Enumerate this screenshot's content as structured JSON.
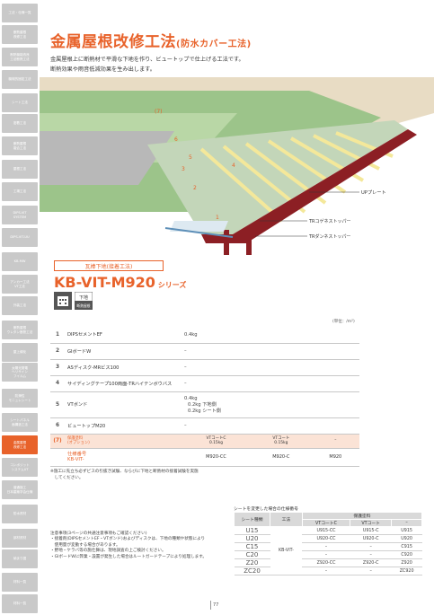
{
  "sidebar": {
    "items": [
      {
        "label": "工法・仕様一覧",
        "active": false
      },
      {
        "label": "断熱屋根\n改修工法",
        "active": false
      },
      {
        "label": "断熱機能改良\n工法断熱工法",
        "active": false
      },
      {
        "label": "機械的固定工法",
        "active": false
      },
      {
        "label": "シート工法",
        "active": false
      },
      {
        "label": "密着工法",
        "active": false
      },
      {
        "label": "断熱屋根\n複合工法",
        "active": false
      },
      {
        "label": "屋根工法",
        "active": false
      },
      {
        "label": "工場工法",
        "active": false
      },
      {
        "label": "DIPS-VIT\nSYSTEM",
        "active": false
      },
      {
        "label": "DIPS-VIT-UU",
        "active": false
      },
      {
        "label": "KB-MW",
        "active": false
      },
      {
        "label": "アンカー工法\nVT工法",
        "active": false
      },
      {
        "label": "外装工法",
        "active": false
      },
      {
        "label": "断熱屋根\nウレタン断熱工法",
        "active": false
      },
      {
        "label": "屋上緑化",
        "active": false
      },
      {
        "label": "太陽光発電\nヘリサイン\nフイルム",
        "active": false
      },
      {
        "label": "防滑性\nモニュレシート",
        "active": false
      },
      {
        "label": "シートパネル\n面構造工法",
        "active": false
      },
      {
        "label": "金属屋根\n改修工法",
        "active": true
      },
      {
        "label": "コンポジット\nシステムUT",
        "active": false
      },
      {
        "label": "普通施工\n日本建築学会仕様",
        "active": false
      },
      {
        "label": "防水資材",
        "active": false
      },
      {
        "label": "部材資材",
        "active": false
      },
      {
        "label": "納まり図",
        "active": false
      },
      {
        "label": "材料一覧",
        "active": false
      },
      {
        "label": "材料一覧",
        "active": false
      }
    ]
  },
  "header": {
    "title": "金属屋根改修工法",
    "subtitle": "(防水カバー工法)",
    "lead": "金属屋根上に断熱材で平滑な下地を作り、ビュートップで仕上げる工法です。\n断熱効果や雨音低減効果を生み出します。"
  },
  "illustration": {
    "callouts": [
      "(7)",
      "6",
      "5",
      "4",
      "3",
      "2",
      "1"
    ],
    "labels": {
      "up_plate": "UPプレート",
      "tr_stopper": "TRコゲネストッパー",
      "tr_ten_stopper": "TRダンネストッパー"
    }
  },
  "section": {
    "category": "瓦棒下地(接着工法)",
    "product": "KB-VIT-M920",
    "series": " シリーズ",
    "badge1_icon": "building-icon",
    "badge2_top": "下地",
    "badge2_bottom": "断熱屋根",
    "unit": "(単位：/m²)"
  },
  "spec": {
    "rows": [
      {
        "no": "1",
        "name": "DIPSセメントEF",
        "value": "0.4kg"
      },
      {
        "no": "2",
        "name": "GIボードW",
        "value": "–"
      },
      {
        "no": "3",
        "name": "ASディスク-MRビス100",
        "value": "–"
      },
      {
        "no": "4",
        "name": "サイディングテープ100両面-TRハイテンボウバス",
        "value": "–"
      },
      {
        "no": "5",
        "name": "VTボンド",
        "value": "0.4kg",
        "value2": "0.2kg  下地側",
        "value3": "0.2kg  シート側"
      },
      {
        "no": "6",
        "name": "ビュートップM20",
        "value": "–"
      }
    ],
    "option": {
      "no": "(7)",
      "name1": "保護塗料",
      "name2": "(オプション)",
      "c1a": "VTコートC",
      "c1b": "0.15kg",
      "c2a": "VTコート",
      "c2b": "0.15kg",
      "c3": "–"
    },
    "code": {
      "label1": "仕様番号",
      "label2": "KB-VIT-",
      "c1": "M920-CC",
      "c2": "M920-C",
      "c3": "M920"
    }
  },
  "footnote": "※施工に先立ち必ずビスの引抜き試験、ならびに下地と断熱材の接着試験を実施\n　してください。",
  "notes": "注意事項(3ページの共通注意事項もご確認ください)\n・接着剤(DIPSセメントEF・VTボンド)およびディスクは、下地の種類や状態により\n　使用量が変動する場合があります。\n・野地・ケラバ等の施仕舞は、現地調査の上ご検討ください。\n・GIボードWに弊業・設置が発生した場合はルートガードテープにより処理します。",
  "sheet_table": {
    "title": "シートを変更した場合の仕様番号",
    "headers": {
      "sheet": "シート種類",
      "method": "工法",
      "paint": "保護塗料",
      "c1": "VTコートC",
      "c2": "VTコート",
      "c3": "–"
    },
    "method": "KB-VIT-",
    "rows": [
      {
        "sheet": "U15",
        "c1": "U915-CC",
        "c2": "U915-C",
        "c3": "U915"
      },
      {
        "sheet": "U20",
        "c1": "U920-CC",
        "c2": "U920-C",
        "c3": "U920"
      },
      {
        "sheet": "C15",
        "c1": "–",
        "c2": "–",
        "c3": "C915"
      },
      {
        "sheet": "C20",
        "c1": "–",
        "c2": "–",
        "c3": "C920"
      },
      {
        "sheet": "Z20",
        "c1": "Z920-CC",
        "c2": "Z920-C",
        "c3": "Z920"
      },
      {
        "sheet": "ZC20",
        "c1": "–",
        "c2": "–",
        "c3": "ZC920"
      }
    ]
  },
  "page_number": "77",
  "colors": {
    "accent": "#e8622a",
    "sidebar_gray": "#c9c9c9",
    "option_bg": "#fbe3d6"
  }
}
